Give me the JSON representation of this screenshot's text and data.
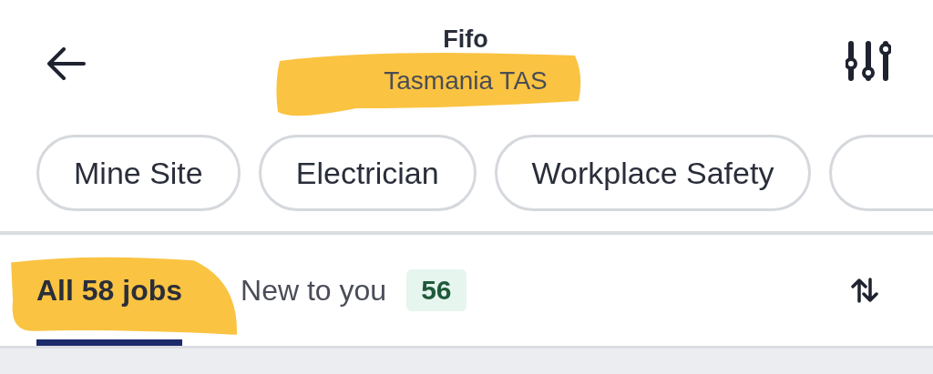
{
  "header": {
    "title": "Fifo",
    "subtitle": "Tasmania TAS"
  },
  "chips": [
    {
      "label": "Mine Site"
    },
    {
      "label": "Electrician"
    },
    {
      "label": "Workplace Safety"
    }
  ],
  "tabs": [
    {
      "label": "All 58 jobs",
      "selected": true
    },
    {
      "label": "New to you",
      "selected": false,
      "badge": "56"
    }
  ]
}
